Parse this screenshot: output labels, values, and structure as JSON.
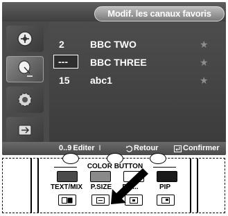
{
  "osd": {
    "title": "Modif. les canaux favoris",
    "sidebar": [
      {
        "icon": "satellite-dish-icon"
      },
      {
        "icon": "antenna-icon"
      },
      {
        "icon": "gear-icon"
      },
      {
        "icon": "input-icon"
      }
    ],
    "channels": [
      {
        "number": "2",
        "name": "BBC TWO",
        "star": "★"
      },
      {
        "number": "---",
        "name": "BBC THREE",
        "star": "★"
      },
      {
        "number": "15",
        "name": "abc1",
        "star": "★"
      }
    ],
    "footer": {
      "edit_label": "Editer",
      "edit_keys": "0..9",
      "separator": "I",
      "back_label": "Retour",
      "confirm_label": "Confirmer"
    }
  },
  "remote": {
    "color_button_caption": "COLOR BUTTON",
    "buttons": [
      {
        "label": "TEXT/MIX",
        "color": "#4a4a4a"
      },
      {
        "label": "P.SIZE",
        "color": "#8a8a8a"
      },
      {
        "label": "P.S...",
        "color": "#ffffff"
      },
      {
        "label": "PIP",
        "color": "#1a1a1a"
      }
    ],
    "pressed_button": "P.SIZE"
  }
}
